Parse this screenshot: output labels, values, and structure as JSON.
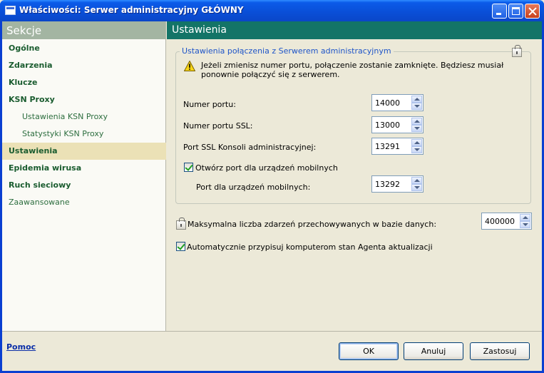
{
  "window": {
    "title": "Właściwości: Serwer administracyjny GŁÓWNY"
  },
  "sidebar": {
    "header": "Sekcje",
    "items": [
      {
        "label": "Ogólne"
      },
      {
        "label": "Zdarzenia"
      },
      {
        "label": "Klucze"
      },
      {
        "label": "KSN Proxy"
      },
      {
        "label": "Ustawienia KSN Proxy"
      },
      {
        "label": "Statystyki KSN Proxy"
      },
      {
        "label": "Ustawienia",
        "selected": true
      },
      {
        "label": "Epidemia wirusa"
      },
      {
        "label": "Ruch sieciowy"
      },
      {
        "label": "Zaawansowane"
      }
    ]
  },
  "main": {
    "header": "Ustawienia",
    "connection_group": {
      "title": "Ustawienia połączenia z Serwerem administracyjnym",
      "warning": "Jeżeli zmienisz numer portu, połączenie zostanie zamknięte. Będziesz musiał ponownie połączyć się z serwerem.",
      "port_label": "Numer portu:",
      "port_value": "14000",
      "ssl_port_label": "Numer portu SSL:",
      "ssl_port_value": "13000",
      "console_ssl_label": "Port SSL Konsoli administracyjnej:",
      "console_ssl_value": "13291",
      "mobile_checkbox_label": "Otwórz port dla urządzeń mobilnych",
      "mobile_checked": true,
      "mobile_port_label": "Port dla urządzeń mobilnych:",
      "mobile_port_value": "13292"
    },
    "max_events_label": "Maksymalna liczba zdarzeń przechowywanych w bazie danych:",
    "max_events_value": "400000",
    "auto_assign_label": "Automatycznie przypisuj komputerom stan Agenta aktualizacji",
    "auto_assign_checked": true
  },
  "footer": {
    "help": "Pomoc",
    "ok": "OK",
    "cancel": "Anuluj",
    "apply": "Zastosuj"
  },
  "colors": {
    "titlebar": "#0a4fd8",
    "sidebar_header": "#a3b5a2",
    "main_header": "#137467",
    "selected_item": "#ebe1b6",
    "nav_text": "#1a5c2f",
    "group_title": "#1f55c8"
  }
}
